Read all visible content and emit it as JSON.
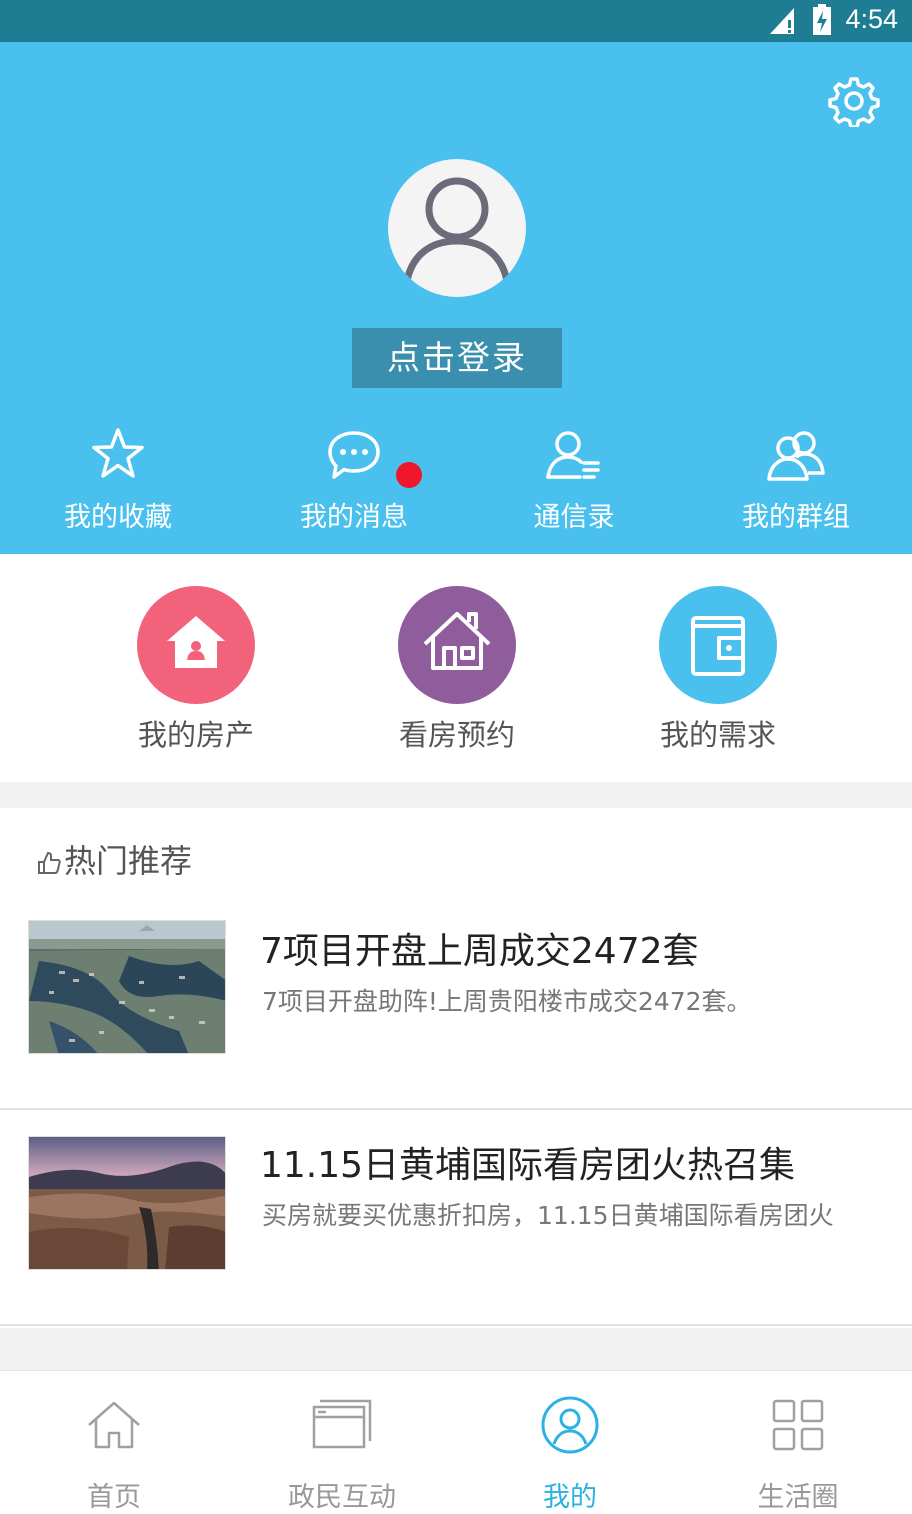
{
  "status_bar": {
    "time": "4:54"
  },
  "header": {
    "login_label": "点击登录",
    "quick_links": [
      {
        "label": "我的收藏",
        "icon": "star-icon"
      },
      {
        "label": "我的消息",
        "icon": "chat-bubble-icon",
        "has_badge": true
      },
      {
        "label": "通信录",
        "icon": "contact-icon"
      },
      {
        "label": "我的群组",
        "icon": "group-icon"
      }
    ],
    "colors": {
      "background": "#4ac0ee",
      "login_button": "#3a8eae",
      "badge": "#f0172c"
    }
  },
  "features": [
    {
      "label": "我的房产",
      "icon": "house-person-icon",
      "color": "#f2627a"
    },
    {
      "label": "看房预约",
      "icon": "house-icon",
      "color": "#8f5c9c"
    },
    {
      "label": "我的需求",
      "icon": "wallet-icon",
      "color": "#4ac0ee"
    }
  ],
  "recommend": {
    "section_title": "热门推荐",
    "items": [
      {
        "title": "7项目开盘上周成交2472套",
        "summary": "7项目开盘助阵!上周贵阳楼市成交2472套。",
        "image": "aerial-waterfront-photo"
      },
      {
        "title": "11.15日黄埔国际看房团火热召集",
        "summary": "买房就要买优惠折扣房，11.15日黄埔国际看房团火",
        "image": "canyon-landscape-photo"
      }
    ]
  },
  "tabbar": {
    "tabs": [
      {
        "label": "首页",
        "icon": "home-icon",
        "active": false
      },
      {
        "label": "政民互动",
        "icon": "window-icon",
        "active": false
      },
      {
        "label": "我的",
        "icon": "user-circle-icon",
        "active": true
      },
      {
        "label": "生活圈",
        "icon": "grid-icon",
        "active": false
      }
    ],
    "active_color": "#2ab2e2"
  }
}
